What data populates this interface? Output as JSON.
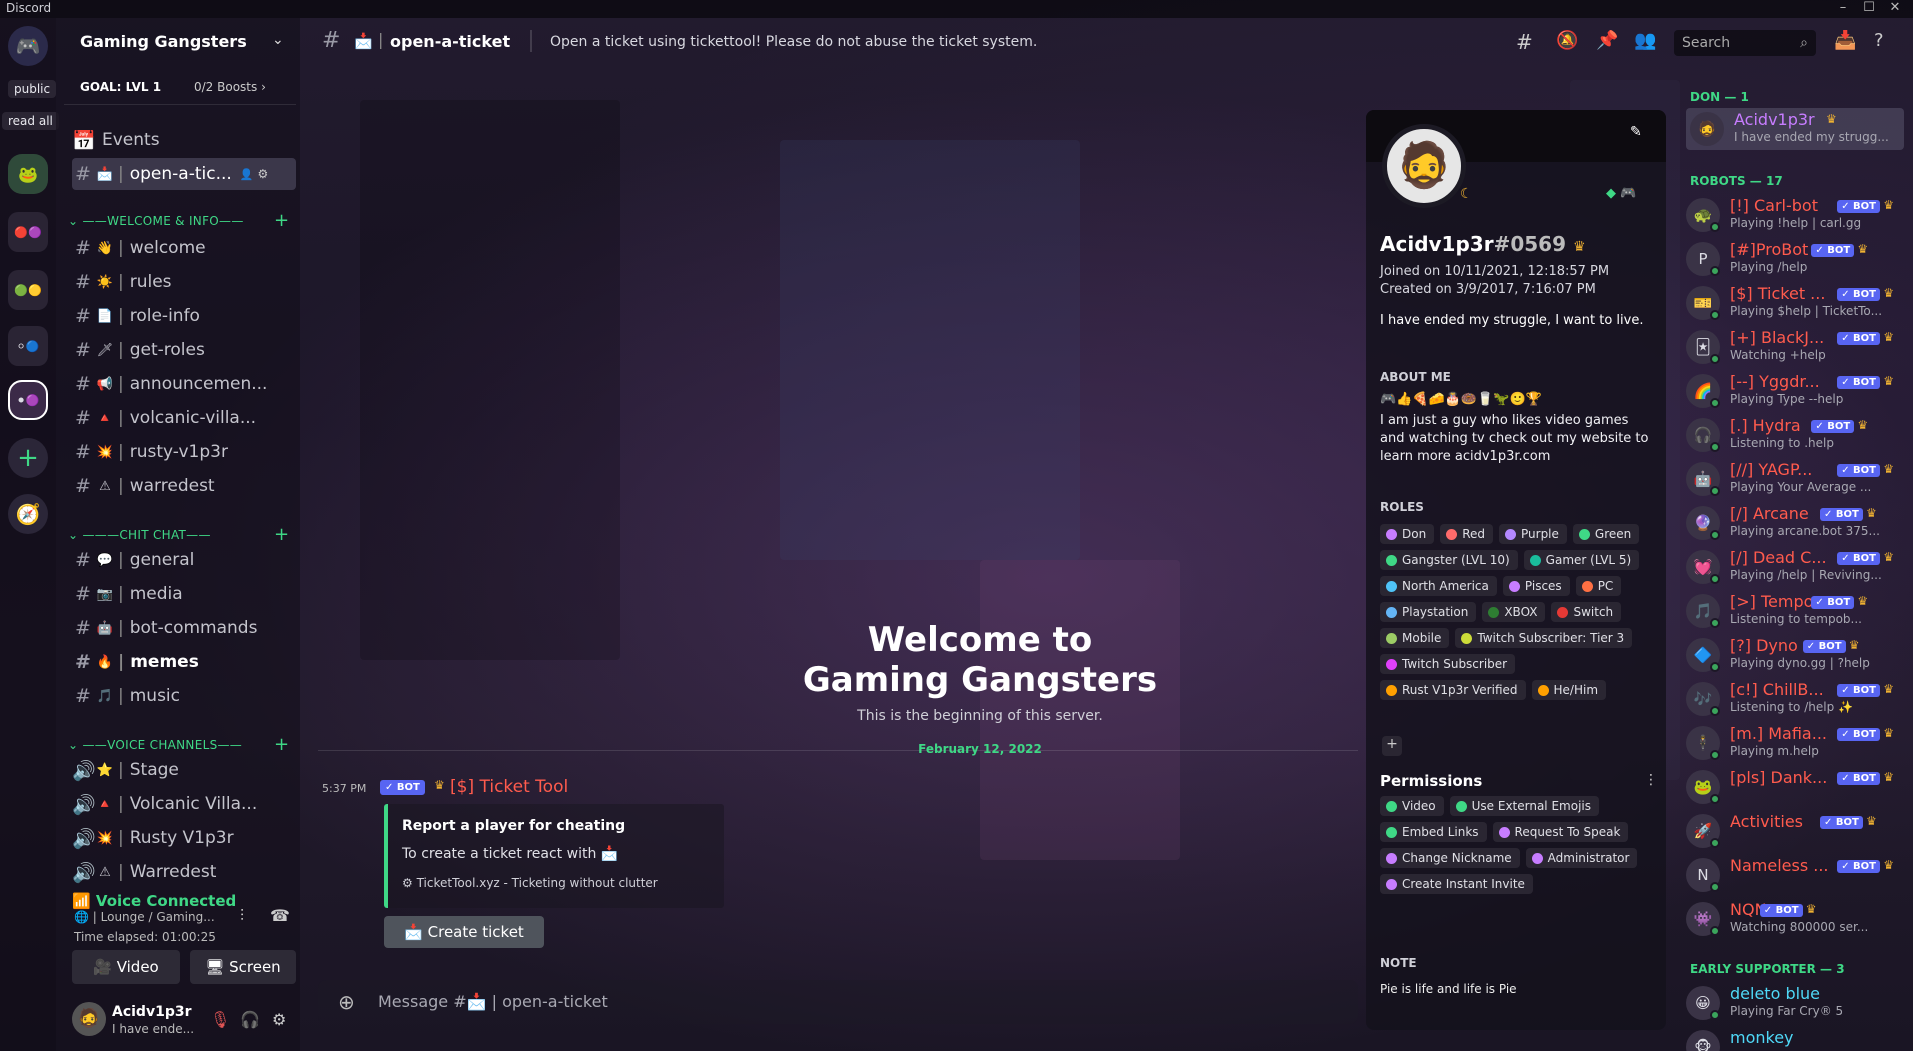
{
  "app_title": "Discord",
  "colors": {
    "accent_green": "#3fd886",
    "bot_badge": "#5865f2",
    "red_name": "#ff5b4d",
    "online": "#3ba55c",
    "crown": "#f0b232"
  },
  "guild_tags": {
    "public": "public",
    "read_all": "read all"
  },
  "server": {
    "name": "Gaming Gangsters",
    "goal": "GOAL: LVL 1",
    "boosts": "0/2 Boosts",
    "events_label": "Events"
  },
  "channels": {
    "active": {
      "emoji": "📩",
      "name": "open-a-tic..."
    },
    "categories": [
      "WELCOME & INFO",
      "CHIT CHAT",
      "VOICE CHANNELS"
    ],
    "welcome_info": [
      {
        "emoji": "👋",
        "name": "welcome"
      },
      {
        "emoji": "☀️",
        "name": "rules"
      },
      {
        "emoji": "📄",
        "name": "role-info"
      },
      {
        "emoji": "🗡",
        "name": "get-roles"
      },
      {
        "emoji": "📢",
        "name": "announcemen..."
      },
      {
        "emoji": "🔺",
        "name": "volcanic-villa..."
      },
      {
        "emoji": "💥",
        "name": "rusty-v1p3r"
      },
      {
        "emoji": "⚠",
        "name": "warredest"
      }
    ],
    "chit_chat": [
      {
        "emoji": "💬",
        "name": "general"
      },
      {
        "emoji": "📷",
        "name": "media"
      },
      {
        "emoji": "🤖",
        "name": "bot-commands"
      },
      {
        "emoji": "🔥",
        "name": "memes"
      },
      {
        "emoji": "🎵",
        "name": "music"
      }
    ],
    "voice": [
      {
        "emoji": "⭐",
        "name": "Stage"
      },
      {
        "emoji": "🔺",
        "name": "Volcanic Villa..."
      },
      {
        "emoji": "💥",
        "name": "Rusty V1p3r"
      },
      {
        "emoji": "⚠",
        "name": "Warredest"
      }
    ]
  },
  "voice_panel": {
    "status": "Voice Connected",
    "location": "Lounge / Gaming...",
    "elapsed": "Time elapsed: 01:00:25",
    "video_label": "Video",
    "screen_label": "Screen"
  },
  "user_panel": {
    "name": "Acidv1p3r",
    "status": "I have ende..."
  },
  "header": {
    "channel_emoji": "📩",
    "channel_name": "open-a-ticket",
    "topic": "Open a ticket using tickettool! Please do not abuse the ticket system.",
    "search_placeholder": "Search"
  },
  "chat": {
    "welcome_line1": "Welcome to",
    "welcome_line2": "Gaming Gangsters",
    "welcome_sub": "This is the beginning of this server.",
    "date_divider": "February 12, 2022",
    "message": {
      "time": "5:37 PM",
      "bot_badge": "BOT",
      "author": "[$] Ticket Tool",
      "embed_title": "Report a player for cheating",
      "embed_desc": "To create a ticket react with",
      "embed_footer": "TicketTool.xyz - Ticketing without clutter",
      "button_label": "Create ticket"
    },
    "input_placeholder": "Message #📩 | open-a-ticket"
  },
  "profile": {
    "username": "Acidv1p3r",
    "discriminator": "#0569",
    "joined": "Joined on 10/11/2021, 12:18:57 PM",
    "created": "Created on 3/9/2017, 7:16:07 PM",
    "custom_status": "I have ended my struggle, I want to live.",
    "about_title": "ABOUT ME",
    "about_emojis": "🎮👍🍕🧀🎂🍩🥛🦖🙂🏆",
    "about_text": "I am just a guy who likes video games and watching tv check out my website to learn more acidv1p3r.com",
    "roles_title": "ROLES",
    "roles": [
      {
        "name": "Don",
        "color": "#c77dff"
      },
      {
        "name": "Red",
        "color": "#ff6b6b"
      },
      {
        "name": "Purple",
        "color": "#b388ff"
      },
      {
        "name": "Green",
        "color": "#3fd886"
      },
      {
        "name": "Gangster (LVL 10)",
        "color": "#3fd886"
      },
      {
        "name": "Gamer (LVL 5)",
        "color": "#1abc9c"
      },
      {
        "name": "North America",
        "color": "#4fc3f7"
      },
      {
        "name": "Pisces",
        "color": "#c77dff"
      },
      {
        "name": "PC",
        "color": "#ff7043"
      },
      {
        "name": "Playstation",
        "color": "#64b5f6"
      },
      {
        "name": "XBOX",
        "color": "#2e7d32"
      },
      {
        "name": "Switch",
        "color": "#e53935"
      },
      {
        "name": "Mobile",
        "color": "#9ccc65"
      },
      {
        "name": "Twitch Subscriber: Tier 3",
        "color": "#cddc39"
      },
      {
        "name": "Twitch Subscriber",
        "color": "#e040fb"
      },
      {
        "name": "Rust V1p3r Verified",
        "color": "#ffa000"
      },
      {
        "name": "He/Him",
        "color": "#ffa000"
      }
    ],
    "permissions_title": "Permissions",
    "permissions": [
      {
        "name": "Video",
        "color": "#3fd886"
      },
      {
        "name": "Use External Emojis",
        "color": "#3fd886"
      },
      {
        "name": "Embed Links",
        "color": "#3fd886"
      },
      {
        "name": "Request To Speak",
        "color": "#c77dff"
      },
      {
        "name": "Change Nickname",
        "color": "#c77dff"
      },
      {
        "name": "Administrator",
        "color": "#c77dff"
      },
      {
        "name": "Create Instant Invite",
        "color": "#c77dff"
      }
    ],
    "note_title": "NOTE",
    "note_text": "Pie is life and life is Pie"
  },
  "members": {
    "don_header": "DON — 1",
    "robots_header": "ROBOTS — 17",
    "early_header": "EARLY SUPPORTER — 3",
    "don": [
      {
        "name": "Acidv1p3r",
        "activity": "I have ended my strugg..."
      }
    ],
    "bots": [
      {
        "name": "[!] Carl-bot",
        "activity": "Playing !help | carl.gg",
        "avatar": "🐢"
      },
      {
        "name": "[#]ProBot",
        "activity": "Playing /help",
        "avatar": "P"
      },
      {
        "name": "[$] Ticket ...",
        "activity": "Playing $help | TicketTo...",
        "avatar": "🎫"
      },
      {
        "name": "[+] BlackJ...",
        "activity": "Watching +help",
        "avatar": "🃏"
      },
      {
        "name": "[--] Yggdr...",
        "activity": "Playing Type --help",
        "avatar": "🌈"
      },
      {
        "name": "[.] Hydra",
        "activity": "Listening to .help",
        "avatar": "🎧"
      },
      {
        "name": "[//] YAGP...",
        "activity": "Playing Your Average ...",
        "avatar": "🤖"
      },
      {
        "name": "[/] Arcane",
        "activity": "Playing arcane.bot 375...",
        "avatar": "🔮"
      },
      {
        "name": "[/] Dead C...",
        "activity": "Playing /help | Reviving...",
        "avatar": "💓"
      },
      {
        "name": "[>] Tempo",
        "activity": "Listening to tempob...",
        "avatar": "🎵"
      },
      {
        "name": "[?] Dyno",
        "activity": "Playing dyno.gg | ?help",
        "avatar": "🔷"
      },
      {
        "name": "[c!] ChillB...",
        "activity": "Listening to /help ✨",
        "avatar": "🎶"
      },
      {
        "name": "[m.] Mafia...",
        "activity": "Playing m.help",
        "avatar": "🕴"
      },
      {
        "name": "[pls] Dank...",
        "activity": "",
        "avatar": "🐸"
      },
      {
        "name": "Activities",
        "activity": "",
        "avatar": "🚀"
      },
      {
        "name": "Nameless ...",
        "activity": "",
        "avatar": "N"
      },
      {
        "name": "NQN",
        "activity": "Watching 800000 ser...",
        "avatar": "👾"
      }
    ],
    "early": [
      {
        "name": "deleto blue",
        "activity": "Playing Far Cry® 5",
        "avatar": "😀"
      },
      {
        "name": "monkey",
        "activity": "",
        "avatar": "🐵"
      }
    ]
  }
}
